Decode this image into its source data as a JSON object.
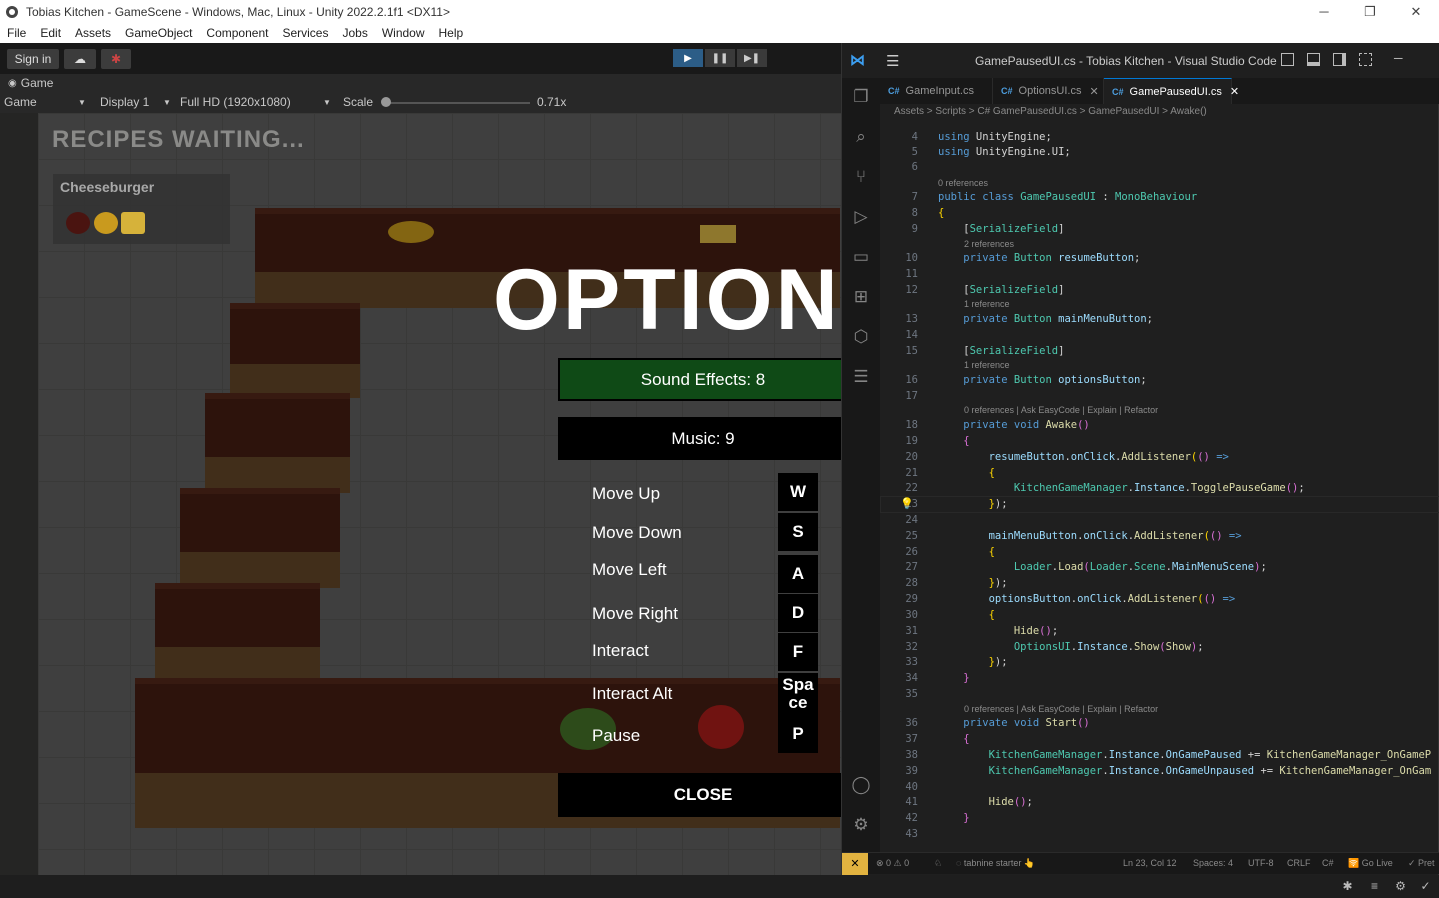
{
  "window": {
    "title": "Tobias Kitchen - GameScene - Windows, Mac, Linux - Unity 2022.2.1f1 <DX11>",
    "min": "─",
    "max": "❐",
    "close": "✕"
  },
  "menu": [
    "File",
    "Edit",
    "Assets",
    "GameObject",
    "Component",
    "Services",
    "Jobs",
    "Window",
    "Help"
  ],
  "toolbar": {
    "sign_in": "Sign in",
    "cloud_icon": "☁",
    "collab_icon": "✱",
    "play": "▶",
    "pause": "❚❚",
    "step": "▶❚"
  },
  "game_tab": {
    "icon": "◉",
    "label": "Game"
  },
  "game_bar": {
    "mode": "Game",
    "display": "Display 1",
    "resolution": "Full HD (1920x1080)",
    "scale_label": "Scale",
    "scale_value": "0.71x",
    "dropdown_icon": "▼"
  },
  "game": {
    "recipes_title": "RECIPES WAITING...",
    "recipe_name": "Cheeseburger",
    "options_title": "OPTION",
    "sound_effects": "Sound Effects: 8",
    "music": "Music: 9",
    "bindings": [
      {
        "label": "Move Up",
        "key": "W"
      },
      {
        "label": "Move Down",
        "key": "S"
      },
      {
        "label": "Move Left",
        "key": "A"
      },
      {
        "label": "Move Right",
        "key": "D"
      },
      {
        "label": "Interact",
        "key": "F"
      },
      {
        "label": "Interact Alt",
        "key": "Spa ce"
      },
      {
        "label": "Pause",
        "key": "P"
      }
    ],
    "close": "CLOSE"
  },
  "vscode": {
    "title": "GamePausedUI.cs - Tobias Kitchen - Visual Studio Code",
    "tabs": [
      "GameInput.cs",
      "OptionsUI.cs",
      "GamePausedUI.cs"
    ],
    "tab_close": "✕",
    "cs": "C#",
    "breadcrumb": "Assets  >  Scripts  >  C#  GamePausedUI.cs  >  GamePausedUI  >  Awake()",
    "line_numbers": [
      "4",
      "5",
      "6",
      "7",
      "8",
      "9",
      "10",
      "11",
      "12",
      "13",
      "14",
      "15",
      "16",
      "17",
      "18",
      "19",
      "20",
      "21",
      "22",
      "23",
      "24",
      "25",
      "26",
      "27",
      "28",
      "29",
      "30",
      "31",
      "32",
      "33",
      "34",
      "35",
      "36",
      "37",
      "38",
      "39",
      "40",
      "41",
      "42",
      "43"
    ],
    "lens_0": "0 references",
    "lens_2": "2 references",
    "lens_1": "1 reference",
    "lens_ask": "0 references | Ask EasyCode | Explain | Refactor",
    "status": {
      "remote": "✕",
      "problems": "⊗ 0 ⚠ 0",
      "bell": "♘",
      "tabnine": "◌ tabnine starter 👆",
      "position": "Ln 23, Col 12",
      "spaces": "Spaces: 4",
      "encoding": "UTF-8",
      "eol": "CRLF",
      "lang": "C#",
      "live": "🛜 Go Live",
      "prettier": "✓ Pret"
    }
  }
}
